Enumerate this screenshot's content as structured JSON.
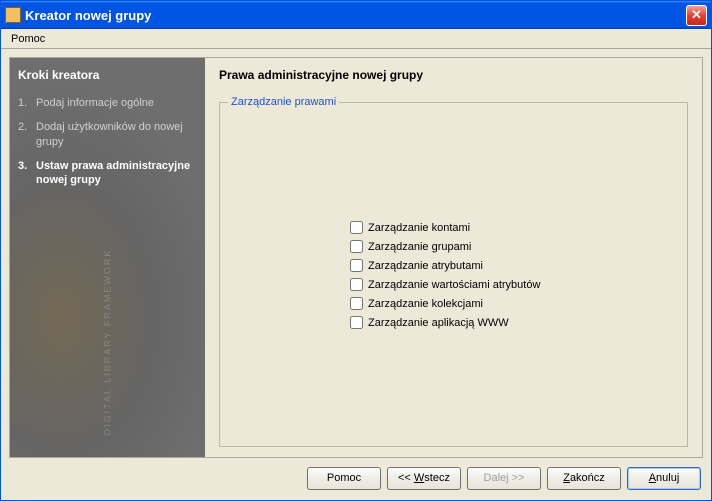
{
  "window": {
    "title": "Kreator nowej grupy"
  },
  "menu": {
    "help": "Pomoc"
  },
  "sidebar": {
    "title": "Kroki kreatora",
    "steps": [
      {
        "num": "1.",
        "label": "Podaj informacje ogólne"
      },
      {
        "num": "2.",
        "label": "Dodaj użytkowników do nowej grupy"
      },
      {
        "num": "3.",
        "label": "Ustaw prawa administracyjne nowej grupy"
      }
    ],
    "watermark": "DIGITAL LIBRARY FRAMEWORK"
  },
  "panel": {
    "title": "Prawa administracyjne nowej grupy",
    "fieldset_legend": "Zarządzanie prawami",
    "checkboxes": [
      "Zarządzanie kontami",
      "Zarządzanie grupami",
      "Zarządzanie atrybutami",
      "Zarządzanie wartościami atrybutów",
      "Zarządzanie kolekcjami",
      "Zarządzanie aplikacją WWW"
    ]
  },
  "buttons": {
    "help": "Pomoc",
    "back_prefix": "<< ",
    "back_mn": "W",
    "back_suffix": "stecz",
    "next_prefix": "",
    "next_mn": "D",
    "next_suffix": "alej >>",
    "finish_prefix": "",
    "finish_mn": "Z",
    "finish_suffix": "akończ",
    "cancel_prefix": "",
    "cancel_mn": "A",
    "cancel_suffix": "nuluj"
  }
}
